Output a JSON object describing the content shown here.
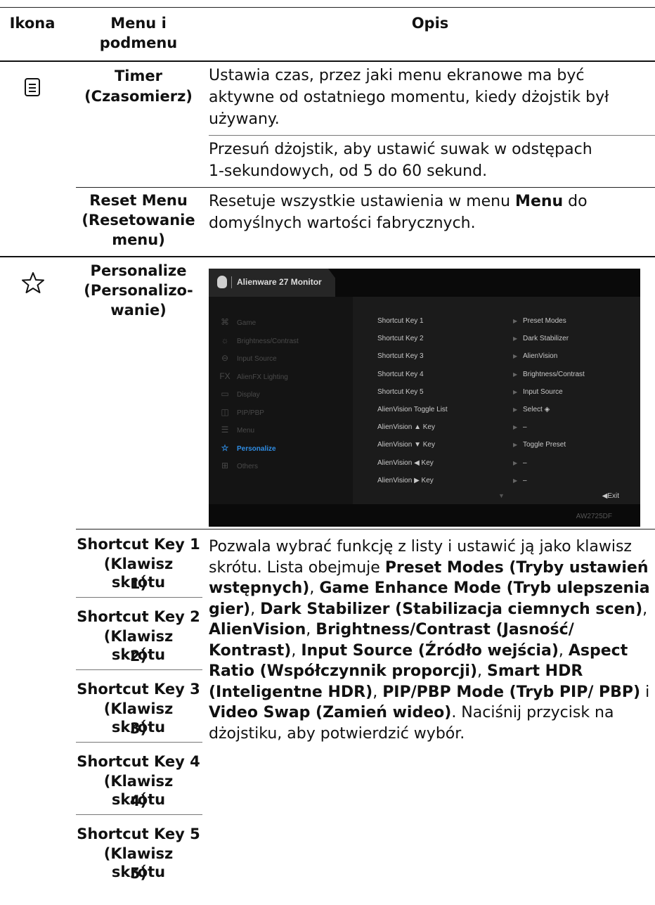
{
  "header": {
    "col_icon": "Ikona",
    "col_menu_line1": "Menu i",
    "col_menu_line2": "podmenu",
    "col_desc": "Opis"
  },
  "timer": {
    "name_line1": "Timer",
    "name_line2": "(Czasomierz)",
    "desc1_l1": "Ustawia czas, przez jaki menu ekranowe ma być",
    "desc1_l2": "aktywne od ostatniego momentu, kiedy dżojstik był",
    "desc1_l3": "używany.",
    "desc2_l1": "Przesuń dżojstik, aby ustawić suwak w odstępach",
    "desc2_l2": "1-sekundowych, od 5 do 60 sekund."
  },
  "reset_menu": {
    "name_line1": "Reset Menu",
    "name_line2": "(Resetowanie",
    "name_line3": "menu)",
    "desc_l1_a": "Resetuje wszystkie ustawienia w menu ",
    "desc_l1_b": "Menu",
    "desc_l1_c": " do",
    "desc_l2": "domyślnych wartości fabrycznych."
  },
  "personalize": {
    "icon": "star-outline-icon",
    "name_line1": "Personalize",
    "name_line2": "(Personalizo-",
    "name_line3": "wanie)"
  },
  "osd": {
    "title": "Alienware 27 Monitor",
    "model": "AW2725DF",
    "exit": "◀Exit",
    "nav": [
      {
        "icon": "gamepad-icon",
        "glyph": "⌘",
        "label": "Game"
      },
      {
        "icon": "brightness-icon",
        "glyph": "☼",
        "label": "Brightness/Contrast"
      },
      {
        "icon": "input-source-icon",
        "glyph": "⊖",
        "label": "Input Source"
      },
      {
        "icon": "alienfx-icon",
        "glyph": "FX",
        "label": "AlienFX Lighting"
      },
      {
        "icon": "display-icon",
        "glyph": "▭",
        "label": "Display"
      },
      {
        "icon": "pip-pbp-icon",
        "glyph": "◫",
        "label": "PIP/PBP"
      },
      {
        "icon": "menu-icon",
        "glyph": "☰",
        "label": "Menu"
      },
      {
        "icon": "star-icon",
        "glyph": "☆",
        "label": "Personalize"
      },
      {
        "icon": "others-icon",
        "glyph": "⊞",
        "label": "Others"
      }
    ],
    "rows": [
      {
        "name": "Shortcut Key 1",
        "value": "Preset Modes"
      },
      {
        "name": "Shortcut Key 2",
        "value": "Dark Stabilizer"
      },
      {
        "name": "Shortcut Key 3",
        "value": "AlienVision"
      },
      {
        "name": "Shortcut Key 4",
        "value": "Brightness/Contrast"
      },
      {
        "name": "Shortcut Key 5",
        "value": "Input Source"
      },
      {
        "name": "AlienVision Toggle List",
        "value": "Select ◈"
      },
      {
        "name": "AlienVision ▲ Key",
        "value": "–"
      },
      {
        "name": "AlienVision ▼ Key",
        "value": "Toggle Preset"
      },
      {
        "name": "AlienVision ◀ Key",
        "value": "–"
      },
      {
        "name": "AlienVision ▶ Key",
        "value": "–"
      }
    ]
  },
  "shortcut_keys": [
    {
      "l1": "Shortcut Key 1",
      "l2": "(Klawisz skrótu",
      "l3": "1)"
    },
    {
      "l1": "Shortcut Key 2",
      "l2": "(Klawisz skrótu",
      "l3": "2)"
    },
    {
      "l1": "Shortcut Key 3",
      "l2": "(Klawisz skrótu",
      "l3": "3)"
    },
    {
      "l1": "Shortcut Key 4",
      "l2": "(Klawisz skrótu",
      "l3": "4)"
    },
    {
      "l1": "Shortcut Key 5",
      "l2": "(Klawisz skrótu",
      "l3": "5)"
    }
  ],
  "shortcut_desc": {
    "t1": "Pozwala wybrać funkcję z listy i ustawić ją jako klawisz",
    "t2": "skrótu. Lista obejmuje ",
    "b1": "Preset Modes (Tryby ustawień wstępnych)",
    "c1": ", ",
    "b2": "Game Enhance Mode (Tryb ulepszenia gier)",
    "c2": ", ",
    "b3": "Dark Stabilizer (Stabilizacja ciemnych scen)",
    "c3": ", ",
    "b4": "AlienVision",
    "c4": ", ",
    "b5": "Brightness/Contrast (Jasność/ Kontrast)",
    "c5": ", ",
    "b6": "Input Source (Źródło wejścia)",
    "c6": ", ",
    "b7": "Aspect Ratio (Współczynnik proporcji)",
    "c7": ", ",
    "b8": "Smart HDR (Inteligentne HDR)",
    "c8": ", ",
    "b9": "PIP/PBP Mode (Tryb PIP/ PBP)",
    "c9": " i ",
    "b10": "Video Swap (Zamień wideo)",
    "t3": ". Naciśnij przycisk na dżojstiku, aby potwierdzić wybór."
  }
}
